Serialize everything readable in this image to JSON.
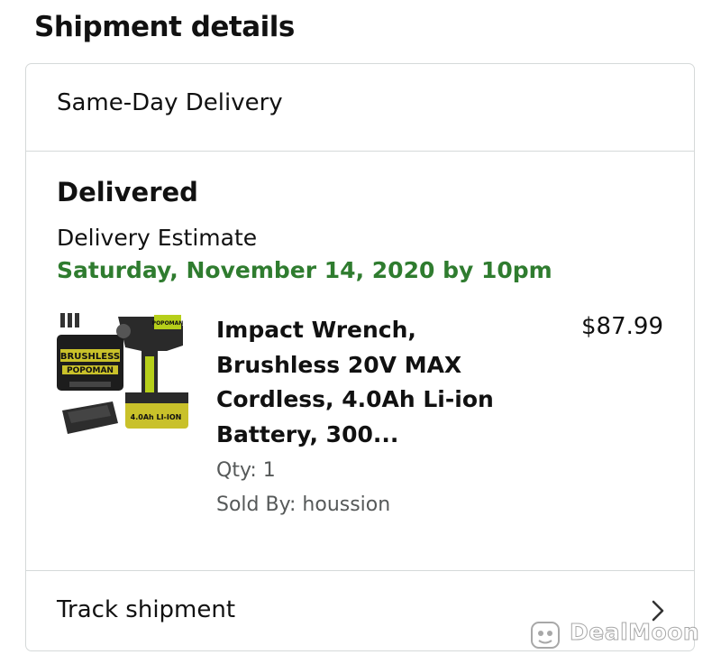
{
  "section": {
    "title": "Shipment details"
  },
  "card": {
    "delivery_type": "Same-Day Delivery",
    "status": "Delivered",
    "estimate_label": "Delivery Estimate",
    "estimate_date": "Saturday, November 14, 2020 by 10pm",
    "item": {
      "title": "Impact Wrench, Brushless 20V MAX Cordless, 4.0Ah Li-ion Battery, 300...",
      "price": "$87.99",
      "qty": "Qty: 1",
      "sold_by": "Sold By: houssion",
      "thumbnail_icon": "impact-wrench-product-image"
    },
    "track_label": "Track shipment"
  },
  "watermark": {
    "text": "DealMoon"
  },
  "colors": {
    "estimate_green": "#2f7c2f",
    "border": "#d5d9d9",
    "muted": "#565959"
  }
}
